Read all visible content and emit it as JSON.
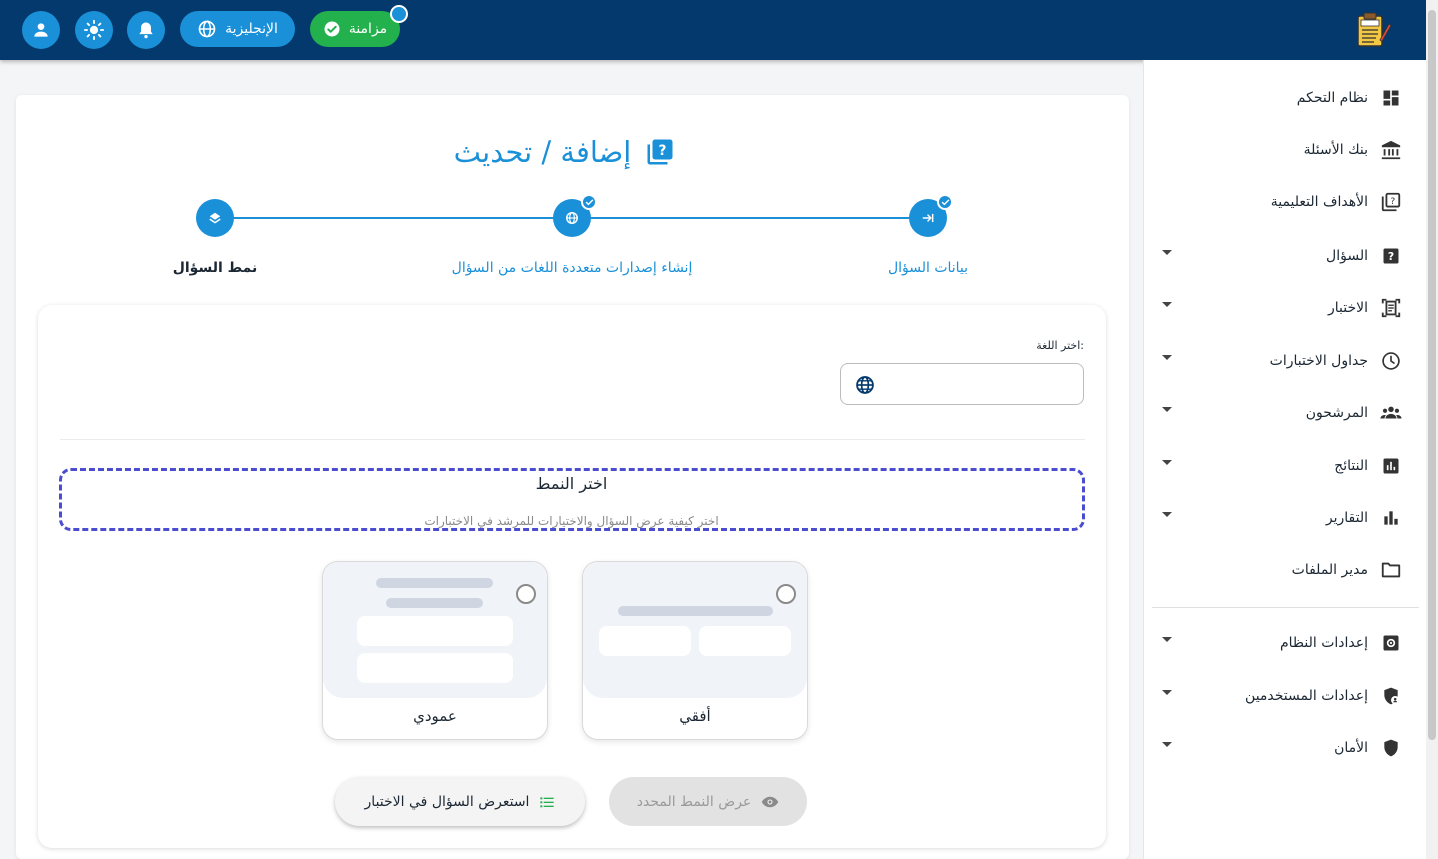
{
  "topbar": {
    "sync_label": "مزامنة",
    "language_label": "الإنجليزية",
    "icons": [
      "user-icon",
      "brightness-icon",
      "bell-icon",
      "globe-icon",
      "check-circle-icon"
    ],
    "colors": {
      "bar": "#03396c",
      "accent": "#1a90d9",
      "sync": "#23b14d"
    }
  },
  "sidebar": {
    "items": [
      {
        "label": "نظام التحكم",
        "icon": "dashboard-icon",
        "has_submenu": false
      },
      {
        "label": "بنك الأسئلة",
        "icon": "bank-icon",
        "has_submenu": false
      },
      {
        "label": "الأهداف التعليمية",
        "icon": "quiz-icon",
        "has_submenu": false
      },
      {
        "label": "السؤال",
        "icon": "help-box-icon",
        "has_submenu": true
      },
      {
        "label": "الاختبار",
        "icon": "document-scanner-icon",
        "has_submenu": true
      },
      {
        "label": "جداول الاختبارات",
        "icon": "clock-icon",
        "has_submenu": true
      },
      {
        "label": "المرشحون",
        "icon": "group-icon",
        "has_submenu": true
      },
      {
        "label": "النتائج",
        "icon": "chart-box-icon",
        "has_submenu": true
      },
      {
        "label": "التقارير",
        "icon": "bar-chart-icon",
        "has_submenu": true
      },
      {
        "label": "مدير الملفات",
        "icon": "folder-icon",
        "has_submenu": false
      }
    ],
    "settings_items": [
      {
        "label": "إعدادات النظام",
        "icon": "settings-icon",
        "has_submenu": true
      },
      {
        "label": "إعدادات المستخدمين",
        "icon": "user-shield-icon",
        "has_submenu": true
      },
      {
        "label": "الأمان",
        "icon": "shield-icon",
        "has_submenu": true
      }
    ]
  },
  "page": {
    "title": "إضافة / تحديث",
    "title_icon": "quiz-icon"
  },
  "stepper": {
    "steps": [
      {
        "label": "بيانات السؤال",
        "icon": "login-arrow-icon",
        "completed": true
      },
      {
        "label": "إنشاء إصدارات متعددة اللغات من السؤال",
        "icon": "globe-icon",
        "completed": true
      },
      {
        "label": "نمط السؤال",
        "icon": "layers-icon",
        "completed": false,
        "active": true
      }
    ]
  },
  "form": {
    "language_label": "اختر اللغة:",
    "language_value": "",
    "pattern_title": "اختر النمط",
    "pattern_subtitle": "اختر كيفية عرض السؤال والاختيارات للمرشد في الاختبارات",
    "layouts": [
      {
        "label": "أفقي",
        "selected": false
      },
      {
        "label": "عمودي",
        "selected": false
      }
    ],
    "preview_button": "استعرض السؤال في الاختبار",
    "show_selected_button": "عرض النمط المحدد"
  }
}
